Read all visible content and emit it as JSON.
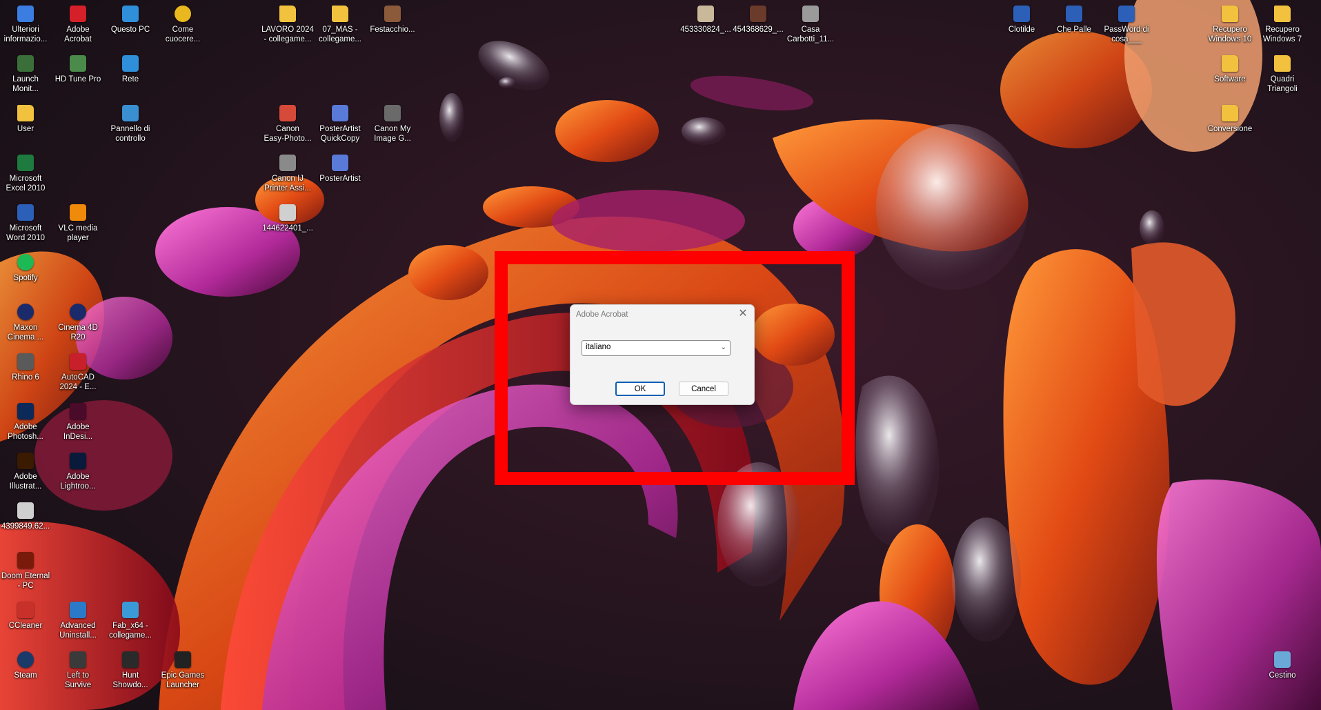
{
  "desktop": {
    "icons": [
      {
        "label": "Ulteriori\ninformazio...",
        "icon": "settings-doc-icon",
        "color": "#3b7de0"
      },
      {
        "label": "Adobe\nAcrobat",
        "icon": "acrobat-icon",
        "color": "#d5202a"
      },
      {
        "label": "Questo PC",
        "icon": "computer-icon",
        "color": "#2f8fd8"
      },
      {
        "label": "Come\ncuocere...",
        "icon": "chrome-icon",
        "color": "#e8b81e"
      },
      {
        "label": "LAVORO 2024\n- collegame...",
        "icon": "folder-icon",
        "color": "#f2c23e"
      },
      {
        "label": "07_MAS -\ncollegame...",
        "icon": "folder-icon",
        "color": "#f2c23e"
      },
      {
        "label": "Festacchio...",
        "icon": "image-icon",
        "color": "#8a5a3a"
      },
      {
        "label": "453330824_...",
        "icon": "image-icon",
        "color": "#c9b89a"
      },
      {
        "label": "454368629_...",
        "icon": "image-icon",
        "color": "#6a3a2a"
      },
      {
        "label": "Casa\nCarbotti_11...",
        "icon": "image-icon",
        "color": "#9a9a9a"
      },
      {
        "label": "Clotilde",
        "icon": "word-doc-icon",
        "color": "#2b5fb8"
      },
      {
        "label": "Che Palle",
        "icon": "word-doc-icon",
        "color": "#2b5fb8"
      },
      {
        "label": "PassWord di\ncosa___",
        "icon": "word-doc-icon",
        "color": "#2b5fb8"
      },
      {
        "label": "Recupero\nWindows 10",
        "icon": "folder-icon",
        "color": "#f2c23e"
      },
      {
        "label": "Recupero\nWindows 7",
        "icon": "folder-icon",
        "color": "#f2c23e"
      },
      {
        "label": "Launch\nMonit...",
        "icon": "monitor-app-icon",
        "color": "#3a6f3a"
      },
      {
        "label": "HD Tune Pro",
        "icon": "hdtune-icon",
        "color": "#4a8a4a"
      },
      {
        "label": "Rete",
        "icon": "network-icon",
        "color": "#2f8fd8"
      },
      {
        "label": "Software",
        "icon": "folder-icon",
        "color": "#f2c23e"
      },
      {
        "label": "Quadri\nTriangoli",
        "icon": "folder-icon",
        "color": "#f2c23e"
      },
      {
        "label": "User",
        "icon": "folder-icon",
        "color": "#f2c23e"
      },
      {
        "label": "Pannello di\ncontrollo",
        "icon": "control-panel-icon",
        "color": "#3a8fd0"
      },
      {
        "label": "Canon\nEasy-Photo...",
        "icon": "canon-icon",
        "color": "#d64a3a"
      },
      {
        "label": "PosterArtist\nQuickCopy",
        "icon": "posterartist-icon",
        "color": "#5a7ad8"
      },
      {
        "label": "Canon My\nImage G...",
        "icon": "canon-image-icon",
        "color": "#6a6a6a"
      },
      {
        "label": "Conversione",
        "icon": "folder-icon",
        "color": "#f2c23e"
      },
      {
        "label": "Microsoft\nExcel 2010",
        "icon": "excel-icon",
        "color": "#1e7a3e"
      },
      {
        "label": "Canon IJ\nPrinter Assi...",
        "icon": "printer-icon",
        "color": "#8a8a8a"
      },
      {
        "label": "PosterArtist",
        "icon": "posterartist-icon",
        "color": "#5a7ad8"
      },
      {
        "label": "Microsoft\nWord 2010",
        "icon": "word-icon",
        "color": "#2b5fb8"
      },
      {
        "label": "VLC media\nplayer",
        "icon": "vlc-icon",
        "color": "#f08a0a"
      },
      {
        "label": "144622401_...",
        "icon": "image-icon",
        "color": "#d0d0d0"
      },
      {
        "label": "Spotify",
        "icon": "spotify-icon",
        "color": "#1db954"
      },
      {
        "label": "Maxon\nCinema ...",
        "icon": "cinema4d-icon",
        "color": "#1a2a6a"
      },
      {
        "label": "Cinema 4D\nR20",
        "icon": "cinema4d-icon",
        "color": "#1a2a6a"
      },
      {
        "label": "Rhino 6",
        "icon": "rhino-icon",
        "color": "#5a5a5a"
      },
      {
        "label": "AutoCAD\n2024 - E...",
        "icon": "autocad-icon",
        "color": "#c8202a"
      },
      {
        "label": "Adobe\nPhotosh...",
        "icon": "photoshop-icon",
        "color": "#0b2a5a"
      },
      {
        "label": "Adobe\nInDesi...",
        "icon": "indesign-icon",
        "color": "#4a0a2a"
      },
      {
        "label": "Adobe\nIllustrat...",
        "icon": "illustrator-icon",
        "color": "#3a1a00"
      },
      {
        "label": "Adobe\nLightroo...",
        "icon": "lightroom-icon",
        "color": "#0a1a3a"
      },
      {
        "label": "4399849.62...",
        "icon": "image-icon",
        "color": "#cfcfcf"
      },
      {
        "label": "Doom Eternal\n- PC",
        "icon": "doom-icon",
        "color": "#7a1a0a"
      },
      {
        "label": "CCleaner",
        "icon": "ccleaner-icon",
        "color": "#c8302a"
      },
      {
        "label": "Advanced\nUninstall...",
        "icon": "uninstaller-icon",
        "color": "#2a7ac8"
      },
      {
        "label": "Fab_x64 -\ncollegame...",
        "icon": "fab-icon",
        "color": "#3a9ad8"
      },
      {
        "label": "Steam",
        "icon": "steam-icon",
        "color": "#1a3a6a"
      },
      {
        "label": "Left to\nSurvive",
        "icon": "game-icon",
        "color": "#3a3a3a"
      },
      {
        "label": "Hunt\nShowdo...",
        "icon": "game-icon",
        "color": "#2a2a2a"
      },
      {
        "label": "Epic Games\nLauncher",
        "icon": "epic-games-icon",
        "color": "#222222"
      },
      {
        "label": "Cestino",
        "icon": "recycle-bin-icon",
        "color": "#6aa8d8"
      }
    ]
  },
  "dialog": {
    "title": "Adobe Acrobat",
    "close_glyph": "✕",
    "language_value": "italiano",
    "ok_label": "OK",
    "cancel_label": "Cancel"
  },
  "colors": {
    "highlight": "#fe0000",
    "primary_button_border": "#0a5fb4"
  }
}
